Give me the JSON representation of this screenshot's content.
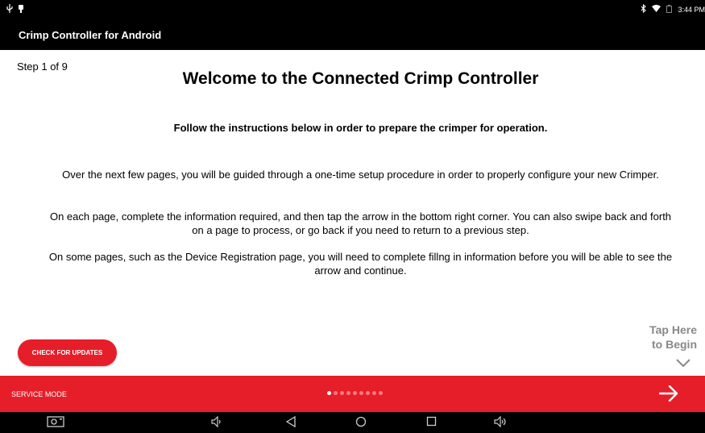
{
  "status_bar": {
    "time": "3:44 PM",
    "icons": [
      "usb-icon",
      "notification-icon",
      "bluetooth-icon",
      "wifi-icon",
      "battery-icon"
    ]
  },
  "app_bar": {
    "title": "Crimp Controller for Android"
  },
  "main": {
    "step_label": "Step 1 of 9",
    "heading": "Welcome to the Connected Crimp Controller",
    "subheading": "Follow the instructions below in order to prepare the crimper for operation.",
    "paragraphs": [
      "Over the next few pages, you will be guided through a one-time setup procedure in order to properly configure your new Crimper.",
      "On each page, complete the information required, and then tap the arrow in the bottom right corner. You can also swipe back and forth on a page to process, or go back if you need to return to a previous step.",
      "On some pages, such as the Device Registration page, you will need to complete fillng in information before you will be able to see the arrow and continue."
    ],
    "check_updates_label": "CHECK FOR UPDATES",
    "tap_here_line1": "Tap Here",
    "tap_here_line2": "to Begin"
  },
  "footer": {
    "service_mode_label": "SERVICE MODE",
    "page_count": 9,
    "current_page": 1
  },
  "colors": {
    "accent": "#e61e2a",
    "bar": "#000000",
    "hint": "#888888"
  },
  "system_nav": {
    "icons": [
      "screenshot-icon",
      "volume-down-icon",
      "back-icon",
      "home-icon",
      "recents-icon",
      "volume-up-icon"
    ]
  }
}
